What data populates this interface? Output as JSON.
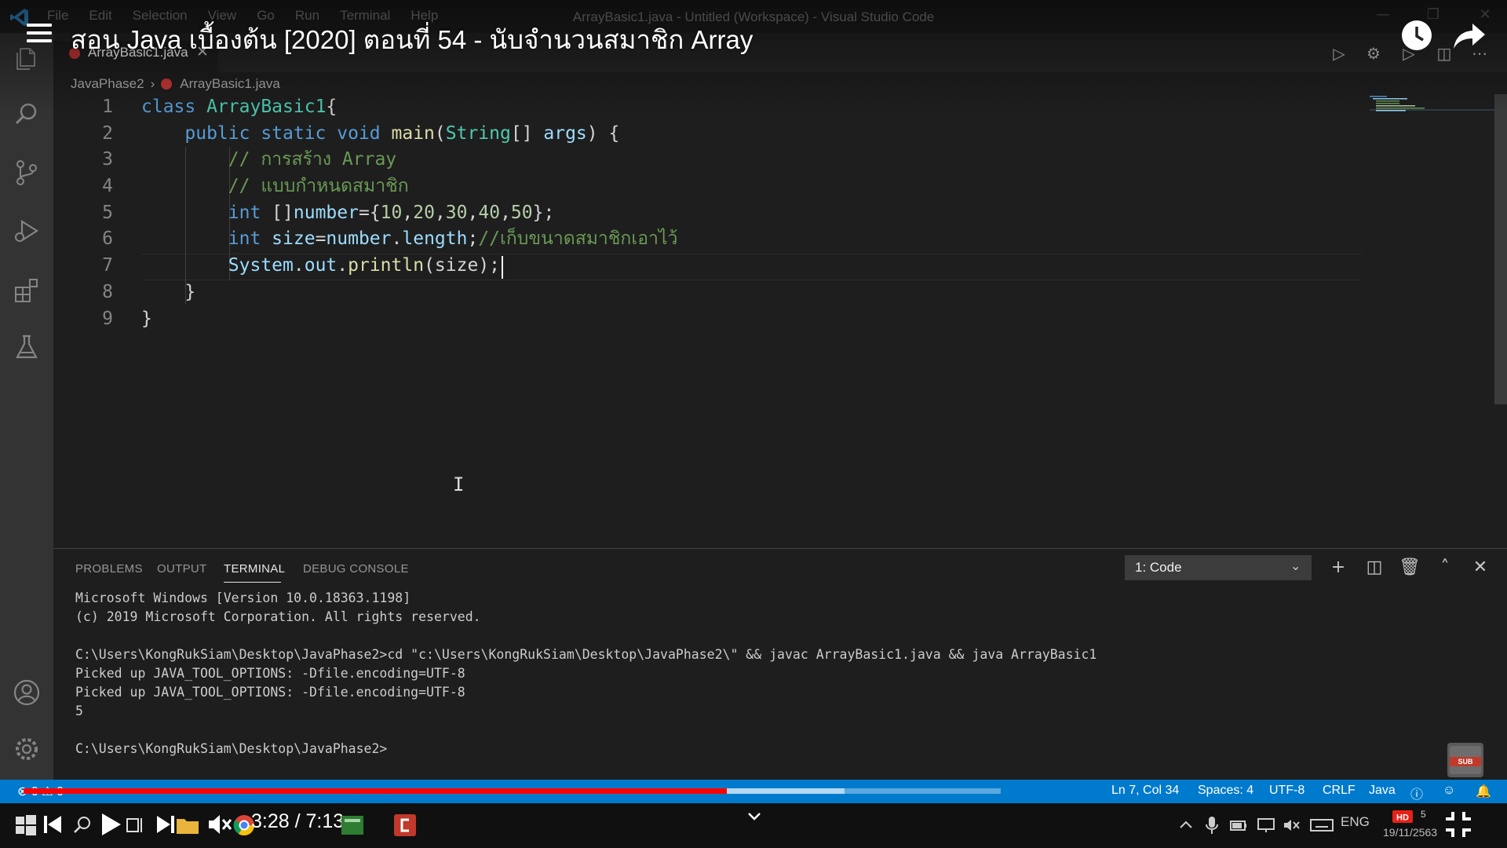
{
  "window": {
    "title": "ArrayBasic1.java - Untitled (Workspace) - Visual Studio Code",
    "menu": [
      "File",
      "Edit",
      "Selection",
      "View",
      "Go",
      "Run",
      "Terminal",
      "Help"
    ]
  },
  "video": {
    "title": "สอน Java เบื้องต้น [2020] ตอนที่ 54 - นับจำนวนสมาชิก Array",
    "time": "3:28 / 7:13",
    "progress_played": 0.72,
    "progress_buffered": 0.84,
    "quality_badge": "HD",
    "sub_badge": "SUB"
  },
  "editor": {
    "tab_label": "ArrayBasic1.java",
    "breadcrumb": {
      "folder": "JavaPhase2",
      "file": "ArrayBasic1.java"
    },
    "line_numbers": [
      "1",
      "2",
      "3",
      "4",
      "5",
      "6",
      "7",
      "8",
      "9"
    ],
    "lines": [
      [
        {
          "t": "class ",
          "c": "kw"
        },
        {
          "t": "ArrayBasic1",
          "c": "cls"
        },
        {
          "t": "{",
          "c": "p"
        }
      ],
      [
        {
          "t": "    ",
          "c": "p"
        },
        {
          "t": "public static void ",
          "c": "kw"
        },
        {
          "t": "main",
          "c": "fn"
        },
        {
          "t": "(",
          "c": "p"
        },
        {
          "t": "String",
          "c": "cls"
        },
        {
          "t": "[] ",
          "c": "p"
        },
        {
          "t": "args",
          "c": "var"
        },
        {
          "t": ") {",
          "c": "p"
        }
      ],
      [
        {
          "t": "        ",
          "c": "p"
        },
        {
          "t": "// การสร้าง Array",
          "c": "cmt"
        }
      ],
      [
        {
          "t": "        ",
          "c": "p"
        },
        {
          "t": "// แบบกำหนดสมาชิก",
          "c": "cmt"
        }
      ],
      [
        {
          "t": "        ",
          "c": "p"
        },
        {
          "t": "int ",
          "c": "kw"
        },
        {
          "t": "[]",
          "c": "p"
        },
        {
          "t": "number",
          "c": "var"
        },
        {
          "t": "={",
          "c": "p"
        },
        {
          "t": "10",
          "c": "num"
        },
        {
          "t": ",",
          "c": "p"
        },
        {
          "t": "20",
          "c": "num"
        },
        {
          "t": ",",
          "c": "p"
        },
        {
          "t": "30",
          "c": "num"
        },
        {
          "t": ",",
          "c": "p"
        },
        {
          "t": "40",
          "c": "num"
        },
        {
          "t": ",",
          "c": "p"
        },
        {
          "t": "50",
          "c": "num"
        },
        {
          "t": "};",
          "c": "p"
        }
      ],
      [
        {
          "t": "        ",
          "c": "p"
        },
        {
          "t": "int ",
          "c": "kw"
        },
        {
          "t": "size",
          "c": "var"
        },
        {
          "t": "=",
          "c": "p"
        },
        {
          "t": "number",
          "c": "var"
        },
        {
          "t": ".",
          "c": "p"
        },
        {
          "t": "length",
          "c": "var"
        },
        {
          "t": ";",
          "c": "p"
        },
        {
          "t": "//เก็บขนาดสมาชิกเอาไว้",
          "c": "cmt"
        }
      ],
      [
        {
          "t": "        ",
          "c": "p"
        },
        {
          "t": "System",
          "c": "var"
        },
        {
          "t": ".",
          "c": "p"
        },
        {
          "t": "out",
          "c": "var"
        },
        {
          "t": ".",
          "c": "p"
        },
        {
          "t": "println",
          "c": "fn"
        },
        {
          "t": "(size);",
          "c": "p"
        }
      ],
      [
        {
          "t": "    }",
          "c": "p"
        }
      ],
      [
        {
          "t": "}",
          "c": "p"
        }
      ]
    ]
  },
  "panel": {
    "tabs": [
      "PROBLEMS",
      "OUTPUT",
      "TERMINAL",
      "DEBUG CONSOLE"
    ],
    "active_tab": "TERMINAL",
    "terminal_select": "1: Code",
    "terminal_lines": [
      "Microsoft Windows [Version 10.0.18363.1198]",
      "(c) 2019 Microsoft Corporation. All rights reserved.",
      "",
      "C:\\Users\\KongRukSiam\\Desktop\\JavaPhase2>cd \"c:\\Users\\KongRukSiam\\Desktop\\JavaPhase2\\\" && javac ArrayBasic1.java && java ArrayBasic1",
      "Picked up JAVA_TOOL_OPTIONS: -Dfile.encoding=UTF-8",
      "Picked up JAVA_TOOL_OPTIONS: -Dfile.encoding=UTF-8",
      "5",
      "",
      "C:\\Users\\KongRukSiam\\Desktop\\JavaPhase2>"
    ]
  },
  "statusbar": {
    "errors": "0",
    "warnings": "0",
    "position": "Ln 7, Col 34",
    "spaces": "Spaces: 4",
    "encoding": "UTF-8",
    "eol": "CRLF",
    "language": "Java"
  },
  "tray": {
    "lang": "ENG",
    "date": "19/11/2563",
    "notif_count": "5"
  },
  "colors": {
    "accent": "#007acc",
    "progress": "#ff0000",
    "file_icon": "#c73737"
  }
}
